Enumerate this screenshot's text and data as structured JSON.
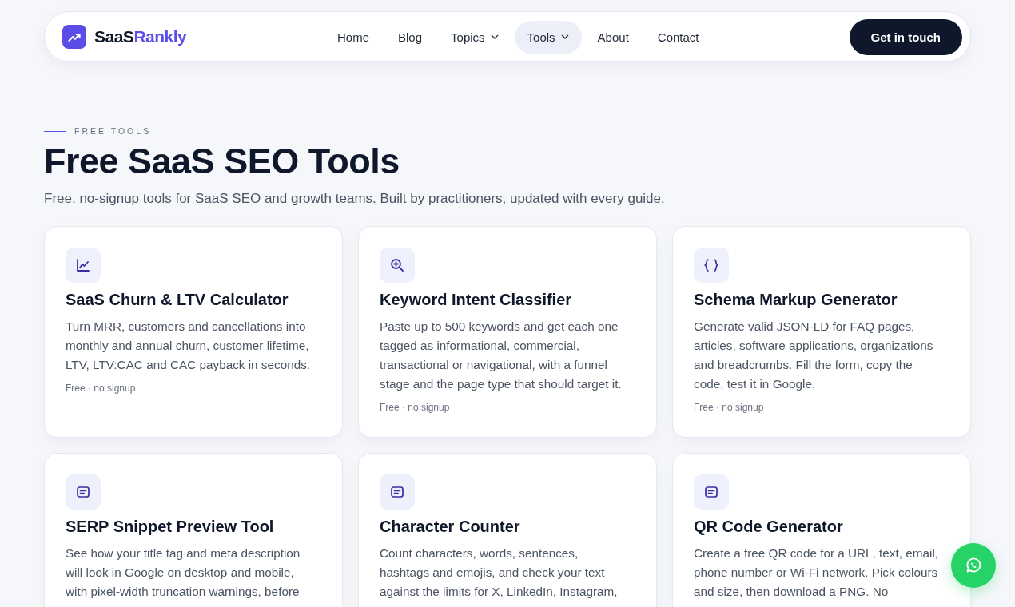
{
  "header": {
    "brand_dark": "SaaS",
    "brand_accent": "Rankly",
    "nav": [
      {
        "label": "Home",
        "selected": false,
        "dropdown": false
      },
      {
        "label": "Blog",
        "selected": false,
        "dropdown": false
      },
      {
        "label": "Topics",
        "selected": false,
        "dropdown": true
      },
      {
        "label": "Tools",
        "selected": true,
        "dropdown": true
      },
      {
        "label": "About",
        "selected": false,
        "dropdown": false
      },
      {
        "label": "Contact",
        "selected": false,
        "dropdown": false
      }
    ],
    "cta": "Get in touch"
  },
  "eyebrow": "FREE TOOLS",
  "title": "Free SaaS SEO Tools",
  "subtitle": "Free, no-signup tools for SaaS SEO and growth teams. Built by practitioners, updated with every guide.",
  "tools": [
    {
      "kind": "chart",
      "title": "SaaS Churn & LTV Calculator",
      "description": "Turn MRR, customers and cancellations into monthly and annual churn, customer lifetime, LTV, LTV:CAC and CAC payback in seconds.",
      "note": "Free · no signup"
    },
    {
      "kind": "search",
      "title": "Keyword Intent Classifier",
      "description": "Paste up to 500 keywords and get each one tagged as informational, commercial, transactional or navigational, with a funnel stage and the page type that should target it.",
      "note": "Free · no signup"
    },
    {
      "kind": "braces",
      "title": "Schema Markup Generator",
      "description": "Generate valid JSON-LD for FAQ pages, articles, software applications, organizations and breadcrumbs. Fill the form, copy the code, test it in Google.",
      "note": "Free · no signup"
    },
    {
      "kind": "document",
      "title": "SERP Snippet Preview Tool",
      "description": "See how your title tag and meta description will look in Google on desktop and mobile, with pixel-width truncation warnings, before"
    },
    {
      "kind": "document",
      "title": "Character Counter",
      "description": "Count characters, words, sentences, hashtags and emojis, and check your text against the limits for X, LinkedIn, Instagram,"
    },
    {
      "kind": "document",
      "title": "QR Code Generator",
      "description": "Create a free QR code for a URL, text, email, phone number or Wi-Fi network. Pick colours and size, then download a PNG. No"
    }
  ]
}
